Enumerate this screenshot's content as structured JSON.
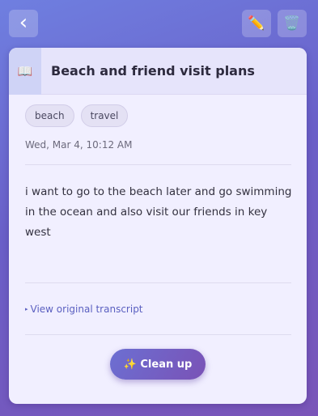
{
  "toolbar": {
    "back_icon": "‹",
    "edit_icon": "✏️",
    "delete_icon": "🗑️"
  },
  "note": {
    "icon": "📖",
    "title": "Beach and friend visit plans",
    "tags": [
      "beach",
      "travel"
    ],
    "date": "Wed, Mar 4, 10:12 AM",
    "body": "i want to go to the beach later and go swimming in the ocean and also visit our friends in key west",
    "transcript_label": "View original transcript",
    "transcript_caret": "▸",
    "cleanup_label": "✨ Clean up"
  },
  "colors": {
    "background_start": "#6f7fe0",
    "background_end": "#7a55b8",
    "card": "#f1efff",
    "accent": "#5a5fc0"
  }
}
